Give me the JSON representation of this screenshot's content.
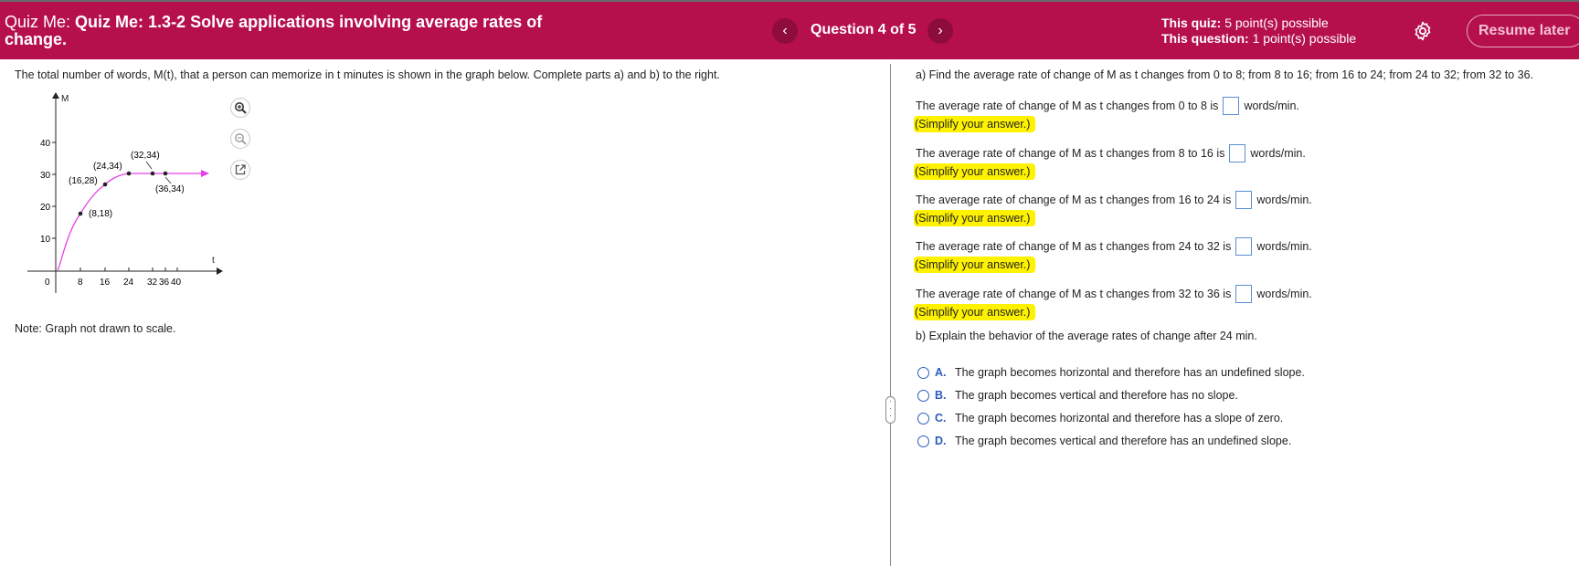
{
  "header": {
    "prefix": "Quiz Me:",
    "title": "Quiz Me: 1.3-2 Solve applications involving average rates of change.",
    "prev_icon": "chevron-left-icon",
    "next_icon": "chevron-right-icon",
    "prev_glyph": "‹",
    "next_glyph": "›",
    "question_counter": "Question 4 of 5",
    "this_quiz_label": "This quiz:",
    "this_quiz_value": "5 point(s) possible",
    "this_question_label": "This question:",
    "this_question_value": "1 point(s) possible",
    "settings_icon": "gear-icon",
    "resume_label": "Resume later",
    "colors": {
      "bar": "#b5104b",
      "nav_button": "#8e0c3a"
    }
  },
  "left": {
    "intro": "The total number of words, M(t), that a person can memorize in t minutes is shown in the graph below. Complete parts a) and b) to the right.",
    "note": "Note: Graph not drawn to scale.",
    "tools": [
      "zoom-in-icon",
      "zoom-out-icon",
      "external-link-icon"
    ],
    "graph": {
      "y_axis_label": "M",
      "x_axis_label": "t",
      "y_ticks": [
        "40",
        "30",
        "20",
        "10"
      ],
      "x_ticks": [
        "0",
        "8",
        "16",
        "24",
        "32",
        "36",
        "40"
      ],
      "curve_color": "#e83ee8",
      "points": [
        {
          "label": "(8,18)",
          "x": 8,
          "y": 18
        },
        {
          "label": "(16,28)",
          "x": 16,
          "y": 28
        },
        {
          "label": "(24,34)",
          "x": 24,
          "y": 34
        },
        {
          "label": "(32,34)",
          "x": 32,
          "y": 34
        },
        {
          "label": "(36,34)",
          "x": 36,
          "y": 34
        }
      ]
    }
  },
  "right": {
    "part_a": "a) Find the average rate of change of M as t changes from 0 to 8; from 8 to 16; from 16 to 24; from 24 to 32; from 32 to 36.",
    "items": [
      {
        "text": "The average rate of change of M as t changes from 0 to 8 is",
        "unit": "words/min.",
        "hint": "(Simplify your answer.)",
        "value": ""
      },
      {
        "text": "The average rate of change of M as t changes from 8 to 16 is",
        "unit": "words/min.",
        "hint": "(Simplify your answer.)",
        "value": ""
      },
      {
        "text": "The average rate of change of M as t changes from 16 to 24 is",
        "unit": "words/min.",
        "hint": "(Simplify your answer.)",
        "value": ""
      },
      {
        "text": "The average rate of change of M as t changes from 24 to 32 is",
        "unit": "words/min.",
        "hint": "(Simplify your answer.)",
        "value": ""
      },
      {
        "text": "The average rate of change of M as t changes from 32 to 36 is",
        "unit": "words/min.",
        "hint": "(Simplify your answer.)",
        "value": ""
      }
    ],
    "part_b": "b) Explain the behavior of the average rates of change after 24 min.",
    "choices": [
      {
        "letter": "A.",
        "text": "The graph becomes horizontal and therefore has an undefined slope.",
        "selected": false
      },
      {
        "letter": "B.",
        "text": "The graph becomes vertical and therefore has no slope.",
        "selected": false
      },
      {
        "letter": "C.",
        "text": "The graph becomes horizontal and therefore has a slope of zero.",
        "selected": false
      },
      {
        "letter": "D.",
        "text": "The graph becomes vertical and therefore has an undefined slope.",
        "selected": false
      }
    ],
    "highlight_color": "#fff200"
  }
}
